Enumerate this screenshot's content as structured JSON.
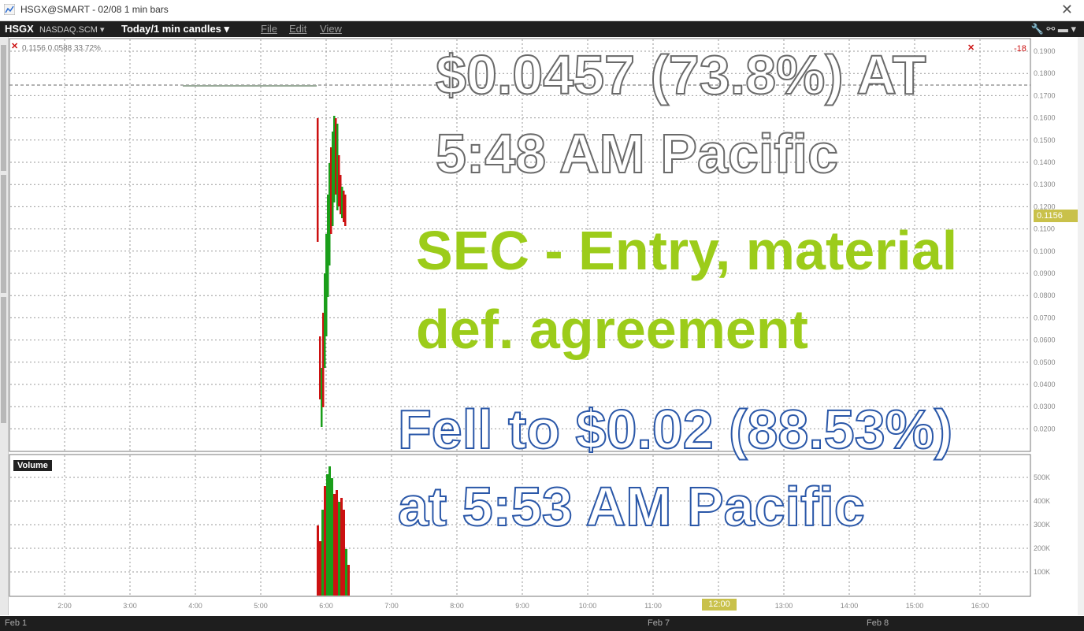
{
  "window": {
    "title": "HSGX@SMART - 02/08 1 min bars",
    "close_glyph": "✕"
  },
  "toolbar": {
    "symbol": "HSGX",
    "exchange": "NASDAQ.SCM ▾",
    "period": "Today/1 min candles ▾",
    "menu_file": "File",
    "menu_edit": "Edit",
    "menu_view": "View",
    "tools_glyphs": "🔧 ⚯ ▬ ▾"
  },
  "chart_info": "0.1156  0.0588  33.72%",
  "price_tag": "0.1156",
  "volume_label": "Volume",
  "x_axis": {
    "ticks": [
      "2:00",
      "3:00",
      "4:00",
      "5:00",
      "6:00",
      "7:00",
      "8:00",
      "9:00",
      "10:00",
      "11:00",
      "12:00",
      "13:00",
      "14:00",
      "15:00",
      "16:00"
    ],
    "highlight": "12:00"
  },
  "y_axis": {
    "ticks": [
      "0.1900",
      "0.1800",
      "0.1700",
      "0.1600",
      "0.1500",
      "0.1400",
      "0.1300",
      "0.1200",
      "0.1100",
      "0.1000",
      "0.0900",
      "0.0800",
      "0.0700",
      "0.0600",
      "0.0500",
      "0.0400",
      "0.0300",
      "0.0200"
    ]
  },
  "volume_axis": {
    "ticks": [
      "500K",
      "400K",
      "300K",
      "200K",
      "100K"
    ]
  },
  "top_right_marker": "-18",
  "bottom_bar": {
    "left": "Feb 1",
    "mid": "Feb 7",
    "right": "Feb 8"
  },
  "overlay": {
    "line1": "$0.0457 (73.8%) AT",
    "line2": "5:48 AM Pacific",
    "line3": "SEC - Entry, material",
    "line4": "def. agreement",
    "line5": "Fell to $0.02 (88.53%)",
    "line6": "at 5:53 AM Pacific"
  },
  "colors": {
    "up": "#1a9e1a",
    "down": "#cc1111",
    "headline_green": "#9ccc1a",
    "tag": "#c9c14a"
  }
}
